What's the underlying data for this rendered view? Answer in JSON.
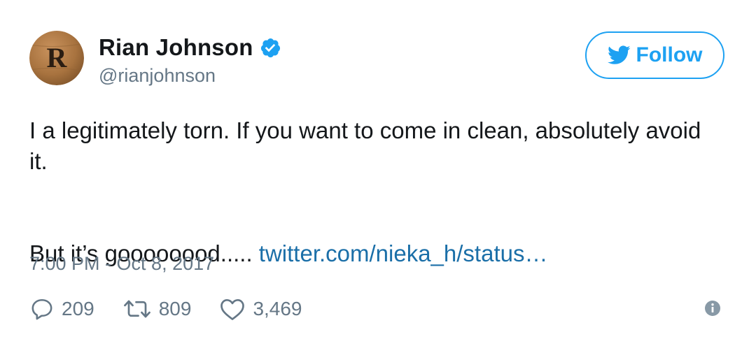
{
  "user": {
    "display_name": "Rian Johnson",
    "handle": "@rianjohnson",
    "avatar_letter": "R",
    "verified": true
  },
  "follow_button": {
    "label": "Follow",
    "icon": "twitter-bird-icon"
  },
  "tweet": {
    "line1": "I a legitimately torn. If you want to come in clean, absolutely avoid it.",
    "line2_text": "But it’s goooooood.....",
    "line2_link": "twitter.com/nieka_h/status…",
    "timestamp": "7:00 PM - Oct 8, 2017"
  },
  "actions": {
    "replies": "209",
    "retweets": "809",
    "likes": "3,469"
  },
  "icons": {
    "reply": "reply-bubble-icon",
    "retweet": "retweet-icon",
    "like": "heart-icon",
    "info": "info-icon",
    "verified": "verified-badge-icon"
  },
  "colors": {
    "accent": "#1da1f2",
    "link": "#1b6fa8",
    "muted": "#657786",
    "text": "#14171a"
  }
}
